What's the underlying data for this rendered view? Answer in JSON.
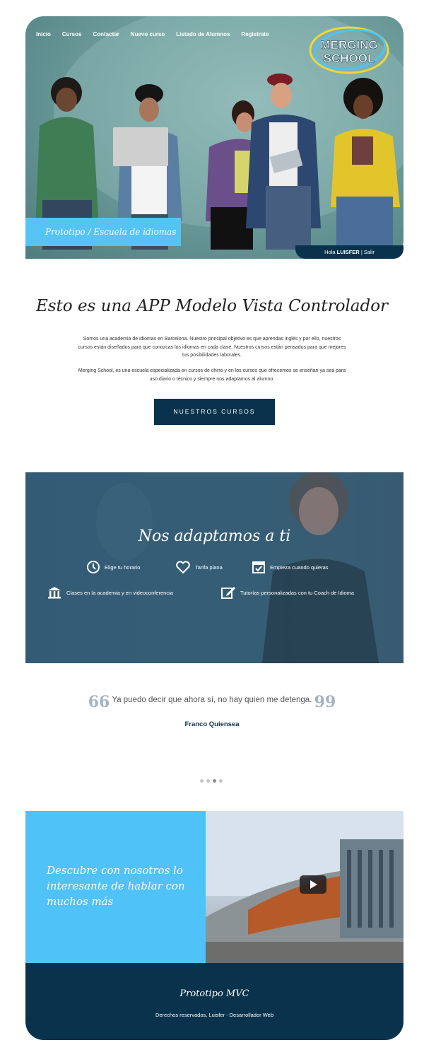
{
  "nav": {
    "items": [
      "Inicio",
      "Cursos",
      "Contactar",
      "Nuevo curso",
      "Listado de Alumnos",
      "Registrate"
    ]
  },
  "logo": {
    "line1": "MERGING",
    "line2": "SCHOOL"
  },
  "hero": {
    "tag": "Prototipo / Escuela de idiomas"
  },
  "user": {
    "greeting": "Hola",
    "name": "LUISFER",
    "separator": "|",
    "logout": "Salir"
  },
  "intro": {
    "title": "Esto es una APP Modelo Vista Controlador",
    "p1": "Somos una academia de idiomas en Barcelona. Nuestro principal objetivo es que aprendas inglés y por ello, nuestros cursos están diseñados para que conozcas los idiomas en cada clase. Nuestros cursos están pensados para que mejores tus posibilidades laborales.",
    "p2": "Merging School, es una escuela especializada en cursos de chino y en los cursos que ofrecemos se enseñan ya sea para uso diario o técnico y siempre nos adaptamos al alumno.",
    "button": "NUESTROS CURSOS"
  },
  "adapt": {
    "title": "Nos adaptamos a ti",
    "features": [
      {
        "label": "Elige tu horario",
        "icon": "clock-icon"
      },
      {
        "label": "Tarifa plana",
        "icon": "heart-icon"
      },
      {
        "label": "Empieza cuando quieras",
        "icon": "calendar-check-icon"
      },
      {
        "label": "Clases en la academia y en videoconferencia",
        "icon": "institution-icon"
      },
      {
        "label": "Tutorías personalizadas con tu Coach de Idioma",
        "icon": "edit-icon"
      }
    ]
  },
  "testimonial": {
    "text": "Ya puedo decir que ahora sí, no hay quien me detenga.",
    "author": "Franco Quiensea",
    "open_quote": "66",
    "close_quote": "99"
  },
  "promo": {
    "text": "Descubre con nosotros lo interesante de hablar con muchos más"
  },
  "footer": {
    "title": "Prototipo MVC",
    "credits": "Derechos reservados, Luisfer - Desarrollador Web"
  },
  "colors": {
    "navy": "#09334d",
    "sky": "#4fc2f7",
    "teal_bg": "#6f9e9d"
  }
}
